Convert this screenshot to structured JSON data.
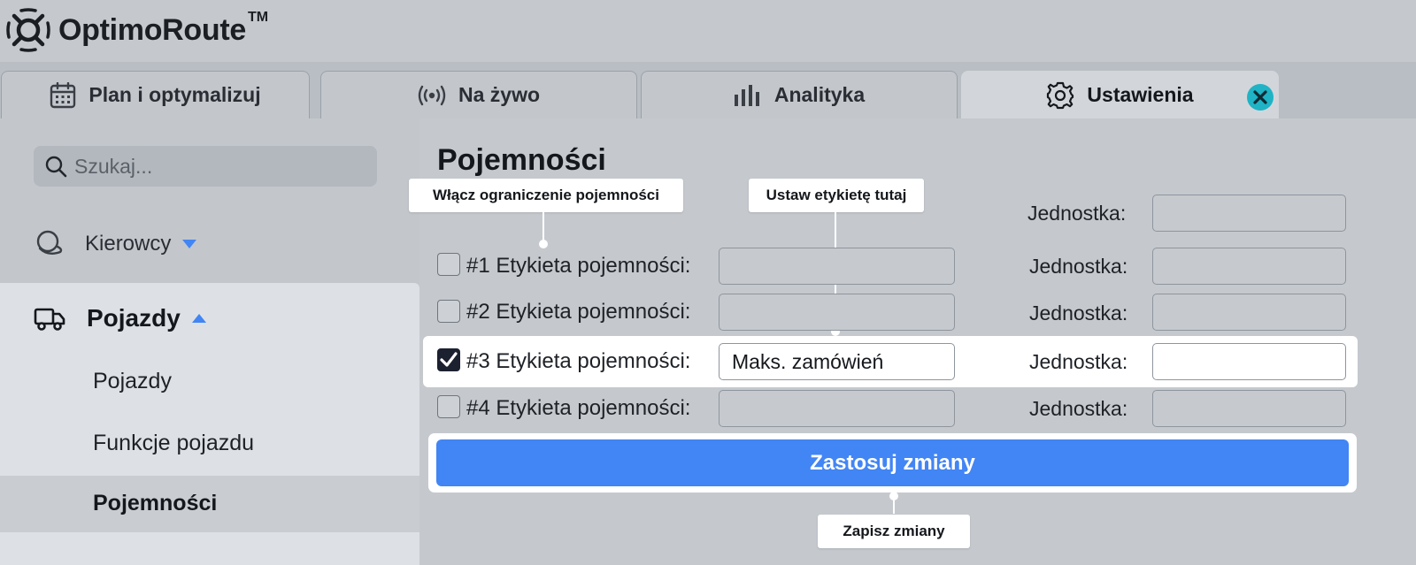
{
  "app": {
    "name": "OptimoRoute",
    "trademark": "TM"
  },
  "tabs": [
    {
      "label": "Plan i optymalizuj",
      "icon": "calendar-icon"
    },
    {
      "label": "Na żywo",
      "icon": "broadcast-icon"
    },
    {
      "label": "Analityka",
      "icon": "bar-chart-icon"
    },
    {
      "label": "Ustawienia",
      "icon": "gear-icon",
      "active": true
    }
  ],
  "sidebar": {
    "search_placeholder": "Szukaj...",
    "drivers_label": "Kierowcy",
    "vehicles_label": "Pojazdy",
    "sub_items": [
      "Pojazdy",
      "Funkcje pojazdu",
      "Pojemności"
    ],
    "active_sub_item": "Pojemności"
  },
  "main": {
    "title": "Pojemności",
    "callouts": {
      "enable_limit": "Włącz ograniczenie pojemności",
      "set_label": "Ustaw etykietę tutaj",
      "save_changes": "Zapisz zmiany"
    },
    "unit_label": "Jednostka:",
    "rows": [
      {
        "label": "#1 Etykieta pojemności:",
        "checked": false,
        "value": "",
        "unit": ""
      },
      {
        "label": "#2 Etykieta pojemności:",
        "checked": false,
        "value": "",
        "unit": ""
      },
      {
        "label": "#3 Etykieta pojemności:",
        "checked": true,
        "value": "Maks. zamówień",
        "unit": ""
      },
      {
        "label": "#4 Etykieta pojemności:",
        "checked": false,
        "value": "",
        "unit": ""
      }
    ],
    "apply_label": "Zastosuj zmiany"
  },
  "colors": {
    "accent": "#4285f4",
    "close_badge": "#1fb3c5",
    "background": "#c5c9ce",
    "checkbox_checked": "#1c2130"
  }
}
